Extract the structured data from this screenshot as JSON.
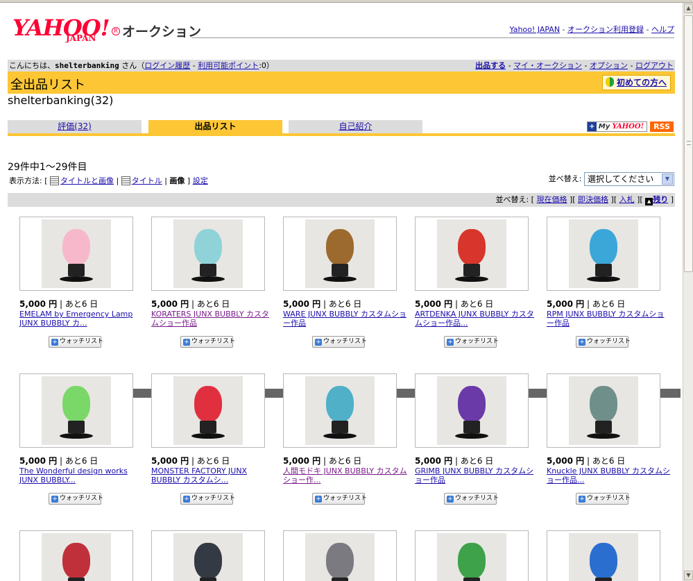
{
  "header": {
    "logo_text": "YAHOO!",
    "logo_sub": "JAPAN",
    "logo_reg": "R",
    "service_name": "オークション",
    "links": [
      "Yahoo! JAPAN",
      "オークション利用登録",
      "ヘルプ"
    ],
    "separator": " - "
  },
  "greeting": {
    "prefix": "こんにちは、",
    "username": "shelterbanking",
    "suffix": " さん（",
    "login_history": "ログイン履歴",
    "points_link": "利用可能ポイント",
    "points_value": ":0）",
    "right_links": [
      "出品する",
      "マイ・オークション",
      "オプション",
      "ログアウト"
    ]
  },
  "title": {
    "text": "全出品リスト",
    "beginner": "初めての方へ"
  },
  "seller": {
    "line": "shelterbanking(32)"
  },
  "tabs": [
    {
      "label": "評価(32)"
    },
    {
      "label": "出品リスト"
    },
    {
      "label": "自己紹介"
    }
  ],
  "badges": {
    "myyahoo_my": "My",
    "myyahoo_y": "YAHOO!",
    "myyahoo_plus": "+",
    "rss": "RSS"
  },
  "listing": {
    "count": "29件中1〜29件目",
    "display_prefix": "表示方法: [",
    "display_options": [
      "タイトルと画像",
      "タイトル",
      "画像"
    ],
    "display_suffix": "]",
    "settings": "設定",
    "sort_label": "並べ替え:",
    "sort_select": "選択してください",
    "sortbar_label": "並べ替え: [",
    "sort_links": [
      "現在価格",
      "即決価格",
      "入札",
      "残り"
    ]
  },
  "icons": {
    "select_arrow": "▼",
    "up_arrow": "▲",
    "watch_plus": "+",
    "scroll_up": "▲",
    "scroll_down": "▼"
  },
  "colors": {
    "accent_yellow": "#fcc634",
    "brand_red": "#ff0033",
    "link": "#1a0dab",
    "visited": "#7a1a8a"
  },
  "watch_label": "ウォッチリスト",
  "items": [
    {
      "price": "5,000 円",
      "rest": " | あと6 日",
      "title": "EMELAM by Emergency Lamp JUNX BUBBLY カ...",
      "color": "#f7b8cc"
    },
    {
      "price": "5,000 円",
      "rest": " | あと6 日",
      "title": "KORATERS JUNX BUBBLY カスタムショー作品",
      "color": "#8fd3d8"
    },
    {
      "price": "5,000 円",
      "rest": " | あと6 日",
      "title": "WARE JUNX BUBBLY カスタムショー作品",
      "color": "#9c6a2e"
    },
    {
      "price": "5,000 円",
      "rest": " | あと6 日",
      "title": "ARTDENKA JUNX BUBBLY カスタムショー作品...",
      "color": "#d8362c"
    },
    {
      "price": "5,000 円",
      "rest": " | あと6 日",
      "title": "RPM JUNX BUBBLY カスタムショー作品",
      "color": "#3aa7d8"
    },
    {
      "price": "5,000 円",
      "rest": " | あと6 日",
      "title": "The Wonderful design works JUNX BUBBLY...",
      "color": "#7ad868"
    },
    {
      "price": "5,000 円",
      "rest": " | あと6 日",
      "title": "MONSTER FACTORY JUNX BUBBLY カスタムシ...",
      "color": "#e03040"
    },
    {
      "price": "5,000 円",
      "rest": " | あと6 日",
      "title": "人間モドキ JUNX BUBBLY カスタムショー作...",
      "color": "#4fb0c8"
    },
    {
      "price": "5,000 円",
      "rest": " | あと6 日",
      "title": "GRIMB JUNX BUBBLY カスタムショー作品",
      "color": "#6a3aa8"
    },
    {
      "price": "5,000 円",
      "rest": " | あと6 日",
      "title": "Knuckle JUNX BUBBLY カスタムショー作品...",
      "color": "#6f8f8a"
    },
    {
      "color": "#c0303a"
    },
    {
      "color": "#333a44"
    },
    {
      "color": "#7a7a80"
    },
    {
      "color": "#3da24a"
    },
    {
      "color": "#2a6fd0"
    }
  ]
}
